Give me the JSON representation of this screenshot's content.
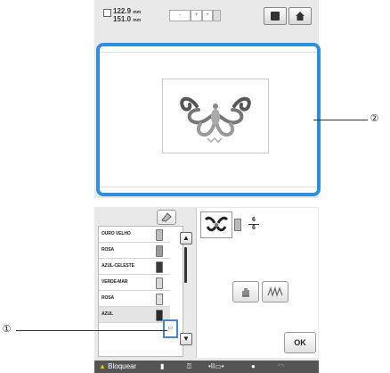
{
  "top_screen": {
    "dims": {
      "width": "122.9",
      "height": "151.0",
      "unit": "mm"
    },
    "frame_sizes": [
      "-",
      "+",
      "+"
    ],
    "toolbar": {
      "frame_button_icon": "square-icon",
      "home_button_icon": "home-icon"
    }
  },
  "bottom_screen": {
    "palette_icon": "palette-icon",
    "threads": [
      {
        "name": "OURO VELHO",
        "color": "#bdbdbd"
      },
      {
        "name": "ROSA",
        "color": "#9a9a9a"
      },
      {
        "name": "AZUL-CELESTE",
        "color": "#3a3a3a"
      },
      {
        "name": "VERDE-MAR",
        "color": "#d8d8d8"
      },
      {
        "name": "ROSA",
        "color": "#e0e0e0"
      },
      {
        "name": "AZUL",
        "color": "#2a2a2a"
      }
    ],
    "stitch_btn_label": "▭",
    "counter": {
      "current": "6",
      "total": "6"
    },
    "hand_icon": "hand-icon",
    "stitch_icon": "stitch-icon",
    "ok_label": "OK",
    "status": {
      "lock_label": "Bloquear"
    }
  },
  "callouts": {
    "one": "①",
    "two": "②"
  },
  "colors": {
    "accent": "#2f8fde",
    "panel": "#e9e9e9",
    "statusbar": "#555555"
  }
}
